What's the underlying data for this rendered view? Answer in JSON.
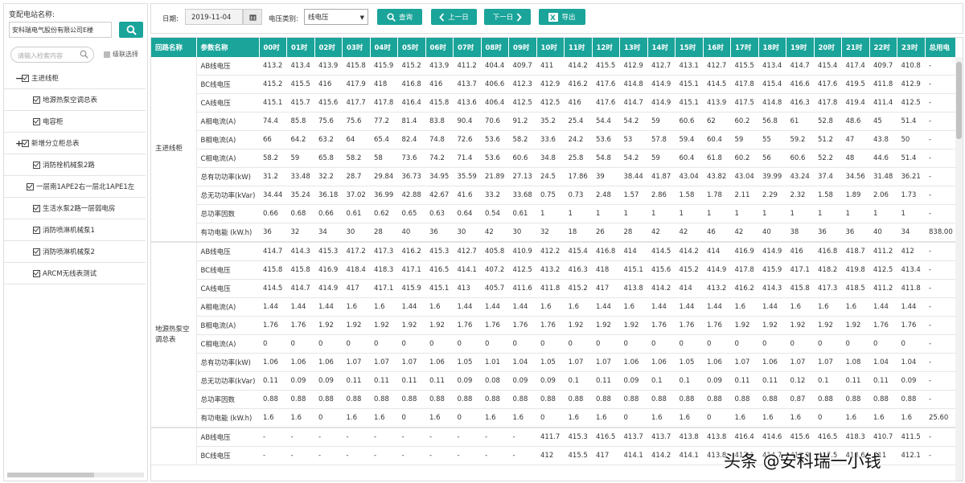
{
  "sidebar": {
    "station_label": "变配电站名称:",
    "station_value": "安科瑞电气股份有限公司E楼",
    "search_placeholder": "请输入检索内容",
    "cascade_label": "级联选择",
    "tree": [
      {
        "level": 0,
        "toggle": "−",
        "label": "主进线柜"
      },
      {
        "level": 1,
        "label": "地源热泵空调总表"
      },
      {
        "level": 1,
        "label": "电容柜"
      },
      {
        "level": 0,
        "toggle": "+",
        "label": "新增分立柜总表"
      },
      {
        "level": 1,
        "label": "消防栓机械泵2路"
      },
      {
        "level": 1,
        "label": "一层南1APE2右一层北1APE1左"
      },
      {
        "level": 1,
        "label": "生活水泵2路一层弱电房"
      },
      {
        "level": 1,
        "label": "消防喷淋机械泵1"
      },
      {
        "level": 1,
        "label": "消防喷淋机械泵2"
      },
      {
        "level": 1,
        "label": "ARCM无线表测试"
      }
    ]
  },
  "toolbar": {
    "date_label": "日期:",
    "date_value": "2019-11-04",
    "voltage_label": "电压类别:",
    "voltage_value": "线电压",
    "query_label": "查询",
    "prev_label": "上一日",
    "next_label": "下一日",
    "export_label": "导出"
  },
  "table": {
    "headers": [
      "回路名称",
      "参数名称",
      "00时",
      "01时",
      "02时",
      "03时",
      "04时",
      "05时",
      "06时",
      "07时",
      "08时",
      "09时",
      "10时",
      "11时",
      "12时",
      "13时",
      "14时",
      "15时",
      "16时",
      "17时",
      "18时",
      "19时",
      "20时",
      "21时",
      "22时",
      "23时",
      "总用电"
    ],
    "groups": [
      {
        "name": "主进线柜",
        "rows": [
          [
            "AB线电压",
            "413.2",
            "413.4",
            "413.9",
            "415.8",
            "415.9",
            "415.2",
            "413.9",
            "411.2",
            "404.4",
            "409.7",
            "411",
            "414.2",
            "415.5",
            "412.9",
            "412.7",
            "413.1",
            "412.7",
            "415.5",
            "413.4",
            "414.7",
            "415.4",
            "417.4",
            "409.7",
            "410.8",
            "-"
          ],
          [
            "BC线电压",
            "415.2",
            "415.5",
            "416",
            "417.9",
            "418",
            "416.8",
            "416",
            "413.7",
            "406.6",
            "412.3",
            "412.9",
            "416.2",
            "417.6",
            "414.8",
            "414.9",
            "415.1",
            "414.5",
            "417.8",
            "415.4",
            "416.6",
            "417.6",
            "419.5",
            "411.8",
            "412.9",
            "-"
          ],
          [
            "CA线电压",
            "415.1",
            "415.7",
            "415.6",
            "417.7",
            "417.8",
            "416.4",
            "415.8",
            "413.6",
            "406.4",
            "412.5",
            "412.5",
            "416",
            "417.6",
            "414.7",
            "414.9",
            "415.1",
            "413.9",
            "417.5",
            "414.8",
            "416.3",
            "417.8",
            "419.4",
            "411.4",
            "412.5",
            "-"
          ],
          [
            "A相电流(A)",
            "74.4",
            "85.8",
            "75.6",
            "75.6",
            "77.2",
            "81.4",
            "83.8",
            "90.4",
            "70.6",
            "91.2",
            "35.2",
            "25.4",
            "54.4",
            "54.2",
            "59",
            "60.6",
            "62",
            "60.2",
            "56.8",
            "61",
            "52.8",
            "48.6",
            "45",
            "51.4",
            "-"
          ],
          [
            "B相电流(A)",
            "66",
            "64.2",
            "63.2",
            "64",
            "65.4",
            "82.4",
            "74.8",
            "72.6",
            "53.6",
            "58.2",
            "33.6",
            "24.2",
            "53.6",
            "53",
            "57.8",
            "59.4",
            "60.4",
            "59",
            "55",
            "59.2",
            "51.2",
            "47",
            "43.8",
            "50",
            "-"
          ],
          [
            "C相电流(A)",
            "58.2",
            "59",
            "65.8",
            "58.2",
            "58",
            "73.6",
            "74.2",
            "71.4",
            "53.6",
            "60.6",
            "34.8",
            "25.8",
            "54.8",
            "54.2",
            "59",
            "60.4",
            "61.8",
            "60.2",
            "56",
            "60.6",
            "52.2",
            "48",
            "44.6",
            "51.4",
            "-"
          ],
          [
            "总有功功率(kW)",
            "31.2",
            "33.48",
            "32.2",
            "28.7",
            "29.84",
            "36.73",
            "34.95",
            "35.59",
            "21.89",
            "27.13",
            "24.5",
            "17.86",
            "39",
            "38.44",
            "41.87",
            "43.04",
            "43.82",
            "43.04",
            "39.99",
            "43.24",
            "37.4",
            "34.56",
            "31.48",
            "36.21",
            "-"
          ],
          [
            "总无功功率(kVar)",
            "34.44",
            "35.24",
            "36.18",
            "37.02",
            "36.99",
            "42.88",
            "42.67",
            "41.6",
            "33.2",
            "33.68",
            "0.75",
            "0.73",
            "2.48",
            "1.57",
            "2.86",
            "1.58",
            "1.78",
            "2.11",
            "2.29",
            "2.32",
            "1.58",
            "1.89",
            "2.06",
            "1.73",
            "-"
          ],
          [
            "总功率因数",
            "0.66",
            "0.68",
            "0.66",
            "0.61",
            "0.62",
            "0.65",
            "0.63",
            "0.64",
            "0.54",
            "0.61",
            "1",
            "1",
            "1",
            "1",
            "1",
            "1",
            "1",
            "1",
            "1",
            "1",
            "1",
            "1",
            "1",
            "1",
            "-"
          ],
          [
            "有功电能 (kW.h)",
            "36",
            "32",
            "34",
            "30",
            "28",
            "40",
            "36",
            "30",
            "42",
            "30",
            "32",
            "18",
            "26",
            "28",
            "42",
            "42",
            "46",
            "42",
            "40",
            "38",
            "36",
            "36",
            "40",
            "34",
            "838.00"
          ]
        ]
      },
      {
        "name": "地源热泵空调总表",
        "rows": [
          [
            "AB线电压",
            "414.7",
            "414.3",
            "415.3",
            "417.2",
            "417.3",
            "416.2",
            "415.3",
            "412.7",
            "405.8",
            "410.9",
            "412.2",
            "415.4",
            "416.8",
            "414",
            "414.5",
            "414.2",
            "414",
            "416.9",
            "414.9",
            "416",
            "416.8",
            "418.7",
            "411.2",
            "412",
            "-"
          ],
          [
            "BC线电压",
            "415.8",
            "415.8",
            "416.9",
            "418.4",
            "418.3",
            "417.1",
            "416.5",
            "414.1",
            "407.2",
            "412.5",
            "413.2",
            "416.3",
            "418",
            "415.1",
            "415.6",
            "415.2",
            "414.9",
            "417.8",
            "415.9",
            "417.1",
            "418.2",
            "419.8",
            "412.5",
            "413.4",
            "-"
          ],
          [
            "CA线电压",
            "414.5",
            "414.7",
            "414.9",
            "417",
            "417.1",
            "415.9",
            "415.1",
            "413",
            "405.7",
            "411.6",
            "411.8",
            "415.2",
            "417",
            "413.8",
            "414.2",
            "414",
            "413.2",
            "416.2",
            "414.3",
            "415.8",
            "417.3",
            "418.5",
            "411.2",
            "411.8",
            "-"
          ],
          [
            "A相电流(A)",
            "1.44",
            "1.44",
            "1.44",
            "1.6",
            "1.6",
            "1.44",
            "1.6",
            "1.44",
            "1.44",
            "1.44",
            "1.6",
            "1.6",
            "1.44",
            "1.6",
            "1.44",
            "1.44",
            "1.44",
            "1.6",
            "1.44",
            "1.6",
            "1.6",
            "1.6",
            "1.44",
            "1.44",
            "-"
          ],
          [
            "B相电流(A)",
            "1.76",
            "1.76",
            "1.92",
            "1.92",
            "1.92",
            "1.92",
            "1.92",
            "1.76",
            "1.76",
            "1.76",
            "1.76",
            "1.92",
            "1.92",
            "1.92",
            "1.76",
            "1.76",
            "1.76",
            "1.92",
            "1.92",
            "1.92",
            "1.92",
            "1.92",
            "1.76",
            "1.76",
            "-"
          ],
          [
            "C相电流(A)",
            "0",
            "0",
            "0",
            "0",
            "0",
            "0",
            "0",
            "0",
            "0",
            "0",
            "0",
            "0",
            "0",
            "0",
            "0",
            "0",
            "0",
            "0",
            "0",
            "0",
            "0",
            "0",
            "0",
            "0",
            "-"
          ],
          [
            "总有功功率(kW)",
            "1.06",
            "1.06",
            "1.06",
            "1.07",
            "1.07",
            "1.07",
            "1.06",
            "1.05",
            "1.01",
            "1.04",
            "1.05",
            "1.07",
            "1.07",
            "1.06",
            "1.06",
            "1.05",
            "1.06",
            "1.07",
            "1.06",
            "1.07",
            "1.07",
            "1.08",
            "1.04",
            "1.04",
            "-"
          ],
          [
            "总无功功率(kVar)",
            "0.11",
            "0.09",
            "0.09",
            "0.11",
            "0.11",
            "0.11",
            "0.11",
            "0.09",
            "0.08",
            "0.09",
            "0.09",
            "0.1",
            "0.11",
            "0.09",
            "0.1",
            "0.1",
            "0.09",
            "0.11",
            "0.11",
            "0.12",
            "0.1",
            "0.11",
            "0.11",
            "0.09",
            "-"
          ],
          [
            "总功率因数",
            "0.88",
            "0.88",
            "0.88",
            "0.88",
            "0.88",
            "0.88",
            "0.88",
            "0.88",
            "0.88",
            "0.88",
            "0.88",
            "0.88",
            "0.88",
            "0.88",
            "0.88",
            "0.88",
            "0.88",
            "0.88",
            "0.88",
            "0.87",
            "0.88",
            "0.88",
            "0.88",
            "0.88",
            "-"
          ],
          [
            "有功电能 (kW.h)",
            "1.6",
            "1.6",
            "0",
            "1.6",
            "1.6",
            "0",
            "1.6",
            "0",
            "1.6",
            "1.6",
            "0",
            "1.6",
            "1.6",
            "0",
            "1.6",
            "1.6",
            "0",
            "1.6",
            "1.6",
            "1.6",
            "0",
            "1.6",
            "1.6",
            "1.6",
            "25.60"
          ]
        ]
      },
      {
        "name": "",
        "rows": [
          [
            "AB线电压",
            "-",
            "-",
            "-",
            "-",
            "-",
            "-",
            "-",
            "-",
            "-",
            "-",
            "411.7",
            "415.3",
            "416.5",
            "413.7",
            "413.7",
            "413.8",
            "413.8",
            "416.4",
            "414.6",
            "415.6",
            "416.5",
            "418.3",
            "410.7",
            "411.5",
            "-"
          ],
          [
            "BC线电压",
            "-",
            "-",
            "-",
            "-",
            "-",
            "-",
            "-",
            "-",
            "-",
            "-",
            "412",
            "415.5",
            "417",
            "414.1",
            "414.2",
            "414.1",
            "413.8",
            "417.1",
            "414.7",
            "415.9",
            "417.5",
            "418.6",
            "411",
            "412.1",
            "-"
          ]
        ]
      }
    ]
  },
  "watermark": "头条 @安科瑞一小钱",
  "colors": {
    "accent": "#1aa49a"
  }
}
